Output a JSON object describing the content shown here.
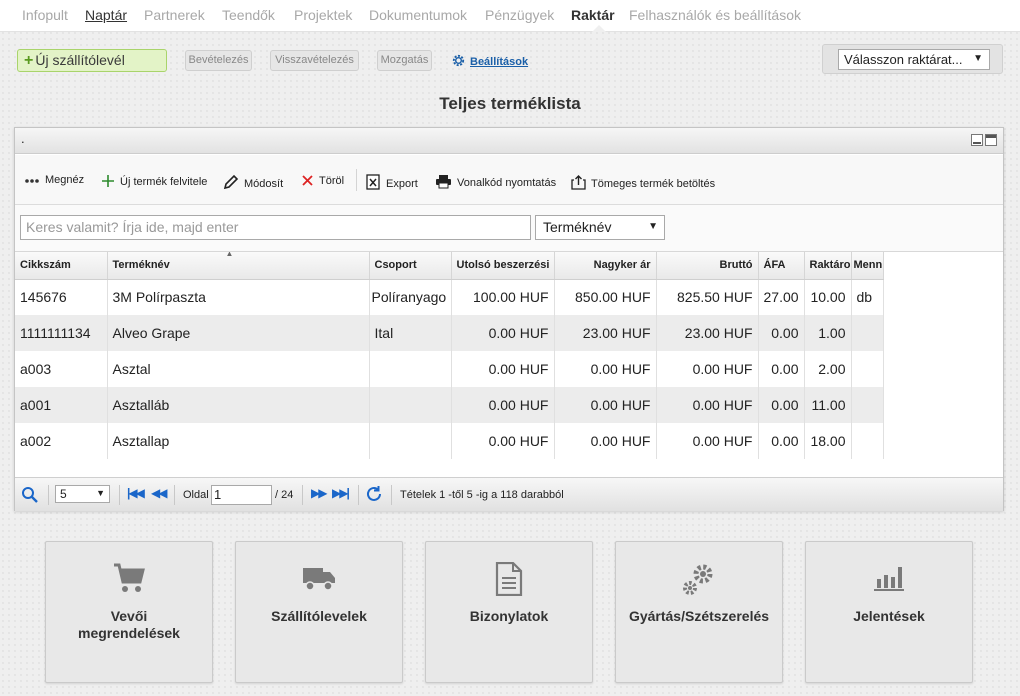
{
  "nav": {
    "items": [
      {
        "label": "Infopult"
      },
      {
        "label": "Naptár"
      },
      {
        "label": "Partnerek"
      },
      {
        "label": "Teendők"
      },
      {
        "label": "Projektek"
      },
      {
        "label": "Dokumentumok"
      },
      {
        "label": "Pénzügyek"
      },
      {
        "label": "Raktár"
      },
      {
        "label": "Felhasználók és beállítások"
      }
    ],
    "active": "Raktár"
  },
  "actions": {
    "new_delivery_note": "Új szállítólevél",
    "receipt": "Bevételezés",
    "return_receipt": "Visszavételezés",
    "movement": "Mozgatás",
    "settings": "Beállítások",
    "warehouse_select": "Válasszon raktárat..."
  },
  "page_title": "Teljes terméklista",
  "panel": {
    "header": ".",
    "toolbar": {
      "view": "Megnéz",
      "add_product": "Új termék felvitele",
      "edit": "Módosít",
      "delete": "Töröl",
      "export": "Export",
      "barcode_print": "Vonalkód nyomtatás",
      "bulk_upload": "Tömeges termék betöltés"
    },
    "search_placeholder": "Keres valamit? Írja ide, majd enter",
    "search_field": "Terméknév",
    "columns": [
      "Cikkszám",
      "Terméknév",
      "Csoport",
      "Utolsó beszerzési",
      "Nagyker ár",
      "Bruttó",
      "ÁFA",
      "Raktáro",
      "Menn"
    ],
    "rows": [
      [
        "145676",
        "3M Polírpaszta",
        "Políranyago",
        "100.00 HUF",
        "850.00 HUF",
        "825.50 HUF",
        "27.00",
        "10.00",
        "db"
      ],
      [
        "1111111134",
        "Alveo Grape",
        "Ital",
        "0.00 HUF",
        "23.00 HUF",
        "23.00 HUF",
        "0.00",
        "1.00",
        ""
      ],
      [
        "a003",
        "Asztal",
        "",
        "0.00 HUF",
        "0.00 HUF",
        "0.00 HUF",
        "0.00",
        "2.00",
        ""
      ],
      [
        "a001",
        "Asztalláb",
        "",
        "0.00 HUF",
        "0.00 HUF",
        "0.00 HUF",
        "0.00",
        "11.00",
        ""
      ],
      [
        "a002",
        "Asztallap",
        "",
        "0.00 HUF",
        "0.00 HUF",
        "0.00 HUF",
        "0.00",
        "18.00",
        ""
      ]
    ],
    "pager": {
      "page_size": "5",
      "page_label": "Oldal",
      "page_value": "1",
      "total_pages": "/ 24",
      "summary": "Tételek 1 -től 5 -ig a 118 darabból"
    }
  },
  "tiles": [
    {
      "label_line1": "Vevői",
      "label_line2": "megrendelések",
      "icon": "cart-icon"
    },
    {
      "label_line1": "Szállítólevelek",
      "label_line2": "",
      "icon": "truck-icon"
    },
    {
      "label_line1": "Bizonylatok",
      "label_line2": "",
      "icon": "document-icon"
    },
    {
      "label_line1": "Gyártás/Szétszerelés",
      "label_line2": "",
      "icon": "gears-icon"
    },
    {
      "label_line1": "Jelentések",
      "label_line2": "",
      "icon": "bar-chart-icon"
    }
  ],
  "colors": {
    "accent_green": "#e3f3c7",
    "link_blue": "#1a5fa8",
    "pager_blue": "#1a66c9",
    "icon_gray": "#7a7a7a"
  }
}
